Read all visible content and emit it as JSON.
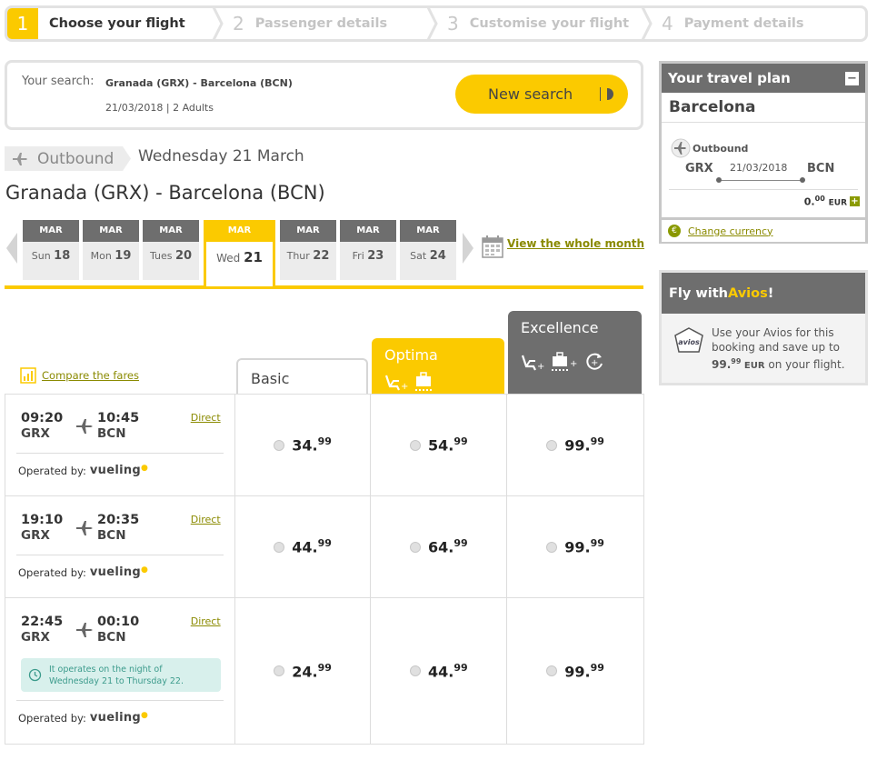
{
  "steps": [
    {
      "num": "1",
      "label": "Choose your flight",
      "active": true
    },
    {
      "num": "2",
      "label": "Passenger details",
      "active": false
    },
    {
      "num": "3",
      "label": "Customise your flight",
      "active": false
    },
    {
      "num": "4",
      "label": "Payment details",
      "active": false
    }
  ],
  "search": {
    "label": "Your search:",
    "route": "Granada (GRX) - Barcelona (BCN)",
    "details": "21/03/2018 | 2 Adults",
    "new_search_label": "New search"
  },
  "outbound": {
    "tag": "Outbound",
    "date": "Wednesday 21 March",
    "route_title": "Granada (GRX) - Barcelona (BCN)"
  },
  "date_tabs": [
    {
      "month": "MAR",
      "day_name": "Sun",
      "day": "18"
    },
    {
      "month": "MAR",
      "day_name": "Mon",
      "day": "19"
    },
    {
      "month": "MAR",
      "day_name": "Tues",
      "day": "20"
    },
    {
      "month": "MAR",
      "day_name": "Wed",
      "day": "21"
    },
    {
      "month": "MAR",
      "day_name": "Thur",
      "day": "22"
    },
    {
      "month": "MAR",
      "day_name": "Fri",
      "day": "23"
    },
    {
      "month": "MAR",
      "day_name": "Sat",
      "day": "24"
    }
  ],
  "view_month_label": "View the whole month",
  "compare_label": "Compare the fares",
  "fares": {
    "basic": "Basic",
    "optima": "Optima",
    "excellence": "Excellence"
  },
  "flights": [
    {
      "dep_time": "09:20",
      "dep_code": "GRX",
      "arr_time": "10:45",
      "arr_code": "BCN",
      "direct": "Direct",
      "operated_by": "Operated by:",
      "airline": "vueling",
      "prices": [
        {
          "int": "34.",
          "dec": "99"
        },
        {
          "int": "54.",
          "dec": "99"
        },
        {
          "int": "99.",
          "dec": "99"
        }
      ]
    },
    {
      "dep_time": "19:10",
      "dep_code": "GRX",
      "arr_time": "20:35",
      "arr_code": "BCN",
      "direct": "Direct",
      "operated_by": "Operated by:",
      "airline": "vueling",
      "prices": [
        {
          "int": "44.",
          "dec": "99"
        },
        {
          "int": "64.",
          "dec": "99"
        },
        {
          "int": "99.",
          "dec": "99"
        }
      ]
    },
    {
      "dep_time": "22:45",
      "dep_code": "GRX",
      "arr_time": "00:10",
      "arr_code": "BCN",
      "direct": "Direct",
      "operated_by": "Operated by:",
      "airline": "vueling",
      "night_note_1": "It operates on the night of",
      "night_note_2": "Wednesday 21 to Thursday 22.",
      "prices": [
        {
          "int": "24.",
          "dec": "99"
        },
        {
          "int": "44.",
          "dec": "99"
        },
        {
          "int": "99.",
          "dec": "99"
        }
      ]
    }
  ],
  "travel_plan": {
    "title": "Your travel plan",
    "collapse": "−",
    "city": "Barcelona",
    "outbound": "Outbound",
    "from": "GRX",
    "to": "BCN",
    "date": "21/03/2018",
    "total_int": "0.",
    "total_dec": "00",
    "currency": "EUR",
    "change_currency": "Change currency"
  },
  "avios": {
    "title_pre": "Fly with ",
    "title_brand": "Avios",
    "title_post": "!",
    "text_1": "Use your Avios for this booking and save up to ",
    "amount_int": "99.",
    "amount_dec": "99",
    "amount_currency": " EUR",
    "text_2": " on your flight.",
    "badge": "avios"
  },
  "colors": {
    "accent": "#fbca00",
    "dark": "#6e6e6e",
    "link": "#8a8a00"
  }
}
